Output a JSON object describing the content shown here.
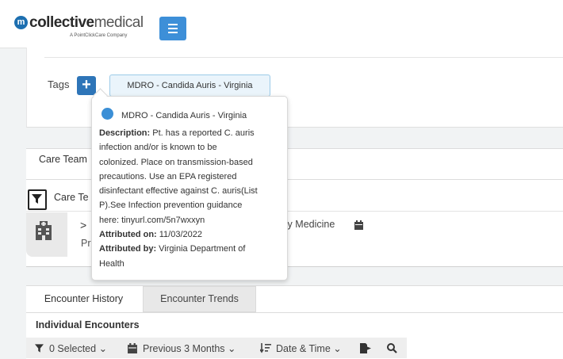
{
  "header": {
    "logo": {
      "brand_bold": "collective",
      "brand_light": "medical",
      "subtitle": "A PointClickCare Company"
    }
  },
  "tags": {
    "label": "Tags",
    "add_icon": "plus-icon",
    "chip_label": "MDRO - Candida Auris - Virginia"
  },
  "popover": {
    "title": "MDRO - Candida Auris - Virginia",
    "description_label": "Description:",
    "description_lines": [
      " Pt. has a reported C. auris",
      "infection and/or is known to be",
      "colonized. Place on transmission-based",
      "precautions. Use an EPA registered",
      "disinfectant effective against C. auris(List",
      "P).See Infection prevention guidance",
      "here: tinyurl.com/5n7wxxyn"
    ],
    "attributed_on_label": "Attributed on:",
    "attributed_on_value": " 11/03/2022",
    "attributed_by_label": "Attributed by:",
    "attributed_by_value": " Virginia Department of",
    "attributed_by_value_cont": "Health"
  },
  "care_team": {
    "tab_label": "Care Team",
    "sub_label": "Care Te",
    "row": {
      "chevron": ">",
      "pr": "Pr",
      "specialty": "ily Medicine"
    }
  },
  "encounters": {
    "tabs": [
      "Encounter History",
      "Encounter Trends"
    ],
    "section_title": "Individual Encounters",
    "toolbar": {
      "selected": "0 Selected",
      "range": "Previous 3 Months",
      "sort": "Date & Time"
    }
  },
  "colors": {
    "brand_blue": "#2e75b8",
    "accent_blue": "#3d8fd8",
    "dot_blue": "#3b8fd6"
  }
}
